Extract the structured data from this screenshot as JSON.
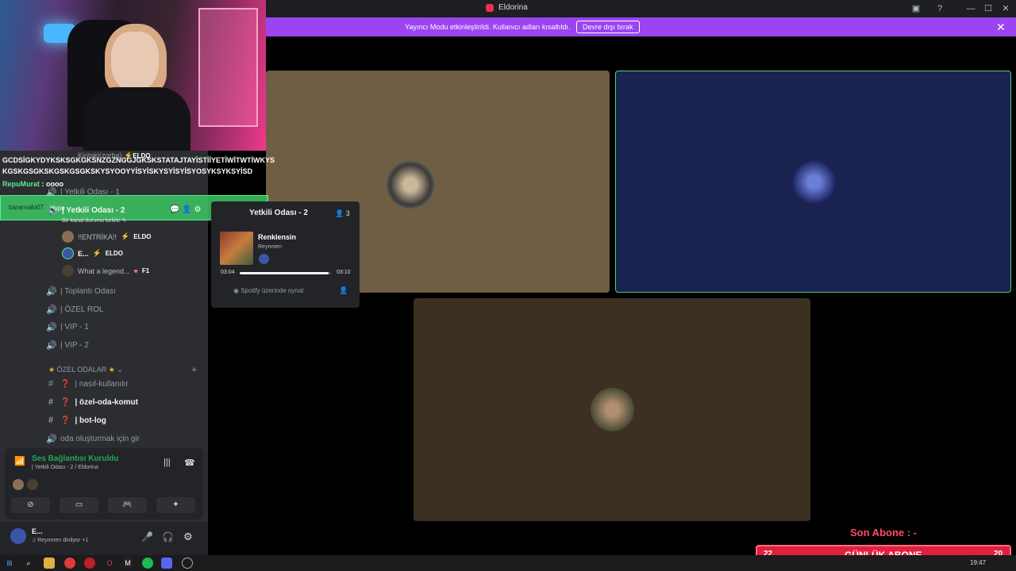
{
  "window": {
    "title": "Eldorina"
  },
  "banner": {
    "text": "Yayıncı Modu etkinleştirildi. Kullanıcı adları kısaltıldı.",
    "button": "Devre dışı bırak"
  },
  "chat": {
    "line1_user": "Kiritaki(zorba)",
    "line1_tag": "ELDO",
    "line2": "GCDSİGKYDYKSKSGKGKSNZGZNGGJGKSKSTATAJTAYİSTİİYETİWİTWTİWKYS",
    "line3": "KGSKGSGKSKGSKGSGKSKYSYOOYYİSYİSKYSYİSYİSYOSYKSYKSYİSD",
    "line4_user": "RepuMurat",
    "line4_text": ": oooo"
  },
  "hype": {
    "name": "baranvalo07",
    "label": "Hype",
    "count": "10"
  },
  "channels": {
    "c1": "| Yetkili Odası - 1",
    "c2": "| Yetkili Odası - 2",
    "c2_status": "Bir kanal durumu belirle",
    "members": [
      {
        "name": "!!ENTRİKA!!",
        "tag": "ELDO"
      },
      {
        "name": "E...",
        "tag": "ELDO"
      },
      {
        "name": "What a legend...",
        "tag": "F1"
      }
    ],
    "c3": "| Toplantı Odası",
    "c4": "| ÖZEL ROL",
    "c5": "| VIP - 1",
    "c6": "| VIP - 2",
    "category": "ÖZEL ODALAR",
    "c7": "| nasıl-kullanılır",
    "c8": "| özel-oda-komut",
    "c9": "| bot-log",
    "c10": "oda oluşturmak için gir"
  },
  "popup": {
    "title": "Yetkili Odası - 2",
    "count": "3",
    "song": "Renklensin",
    "artist": "Reynmen",
    "elapsed": "03:04",
    "total": "03:10",
    "progress": 0.97,
    "spotify": "Spotify üzerinde oynat"
  },
  "voice": {
    "status": "Ses Bağlantısı Kuruldu",
    "channel": "| Yetkili Odası - 2 / Eldorina"
  },
  "user": {
    "name": "E...",
    "activity": "Reynmen dinliyor +1"
  },
  "subs": {
    "last_label": "Son Abone : -",
    "daily_label": "GÜNLÜK ABONE",
    "left": "22",
    "right": "20"
  },
  "taskbar": {
    "time": "19:47"
  },
  "colors": {
    "accent": "#9b44f0",
    "green": "#23a55a",
    "sub_red": "#e0213c"
  }
}
